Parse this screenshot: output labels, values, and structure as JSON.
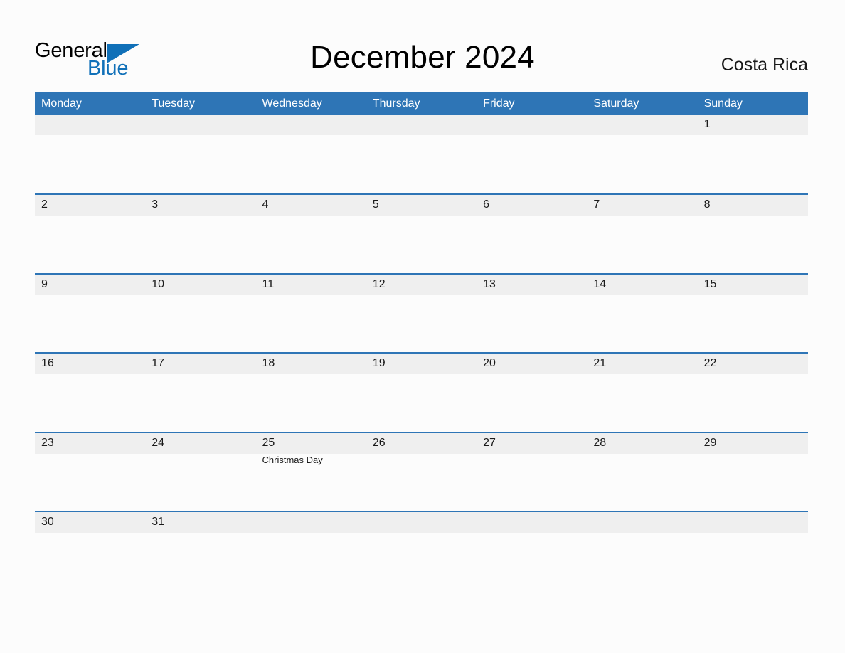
{
  "header": {
    "logo": {
      "part1": "General",
      "part2": "Blue",
      "triangle_color": "#1070b8"
    },
    "title": "December 2024",
    "country": "Costa Rica"
  },
  "theme": {
    "accent": "#2e75b6",
    "band": "#efefef",
    "background": "#fcfcfc",
    "header_text": "#ffffff"
  },
  "calendar": {
    "weekdays": [
      "Monday",
      "Tuesday",
      "Wednesday",
      "Thursday",
      "Friday",
      "Saturday",
      "Sunday"
    ],
    "weeks": [
      {
        "days": [
          {
            "num": ""
          },
          {
            "num": ""
          },
          {
            "num": ""
          },
          {
            "num": ""
          },
          {
            "num": ""
          },
          {
            "num": ""
          },
          {
            "num": "1"
          }
        ]
      },
      {
        "days": [
          {
            "num": "2"
          },
          {
            "num": "3"
          },
          {
            "num": "4"
          },
          {
            "num": "5"
          },
          {
            "num": "6"
          },
          {
            "num": "7"
          },
          {
            "num": "8"
          }
        ]
      },
      {
        "days": [
          {
            "num": "9"
          },
          {
            "num": "10"
          },
          {
            "num": "11"
          },
          {
            "num": "12"
          },
          {
            "num": "13"
          },
          {
            "num": "14"
          },
          {
            "num": "15"
          }
        ]
      },
      {
        "days": [
          {
            "num": "16"
          },
          {
            "num": "17"
          },
          {
            "num": "18"
          },
          {
            "num": "19"
          },
          {
            "num": "20"
          },
          {
            "num": "21"
          },
          {
            "num": "22"
          }
        ]
      },
      {
        "days": [
          {
            "num": "23"
          },
          {
            "num": "24"
          },
          {
            "num": "25",
            "event": "Christmas Day"
          },
          {
            "num": "26"
          },
          {
            "num": "27"
          },
          {
            "num": "28"
          },
          {
            "num": "29"
          }
        ]
      },
      {
        "days": [
          {
            "num": "30"
          },
          {
            "num": "31"
          },
          {
            "num": ""
          },
          {
            "num": ""
          },
          {
            "num": ""
          },
          {
            "num": ""
          },
          {
            "num": ""
          }
        ]
      }
    ]
  }
}
